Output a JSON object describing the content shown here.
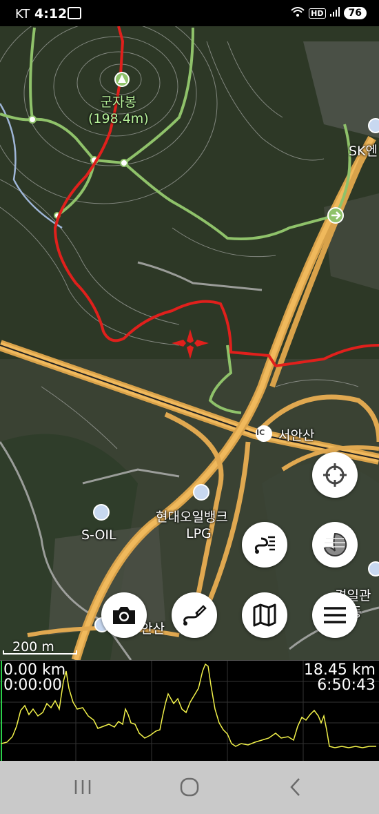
{
  "status_bar": {
    "carrier": "KT",
    "time": "4:12",
    "hd": "HD",
    "battery": "76"
  },
  "map": {
    "peak_name": "군자봉",
    "peak_elevation": "(198.4m)",
    "labels": {
      "sk": "SK엔",
      "ic_badge": "IC",
      "interchange": "서안산",
      "gas_station": "현대오일뱅크",
      "gas_station_sub": "LPG",
      "soil": "S-OIL",
      "school": "경일관",
      "school_sub": "고등",
      "bottom_station": "안산"
    },
    "scale": "200 m"
  },
  "controls": {
    "my_location": "crosshair-locate-icon",
    "layer": "map-layer-icon",
    "route_list": "route-list-icon",
    "camera": "camera-icon",
    "draw_route": "draw-route-icon",
    "map": "folded-map-icon",
    "menu": "hamburger-menu-icon"
  },
  "profile": {
    "start_distance": "0.00 km",
    "start_time": "0:00:00",
    "total_distance": "18.45 km",
    "total_time": "6:50:43",
    "line_color": "#f2f24a"
  },
  "route_color": "#e0201c",
  "trail_color": "#8fc26a"
}
